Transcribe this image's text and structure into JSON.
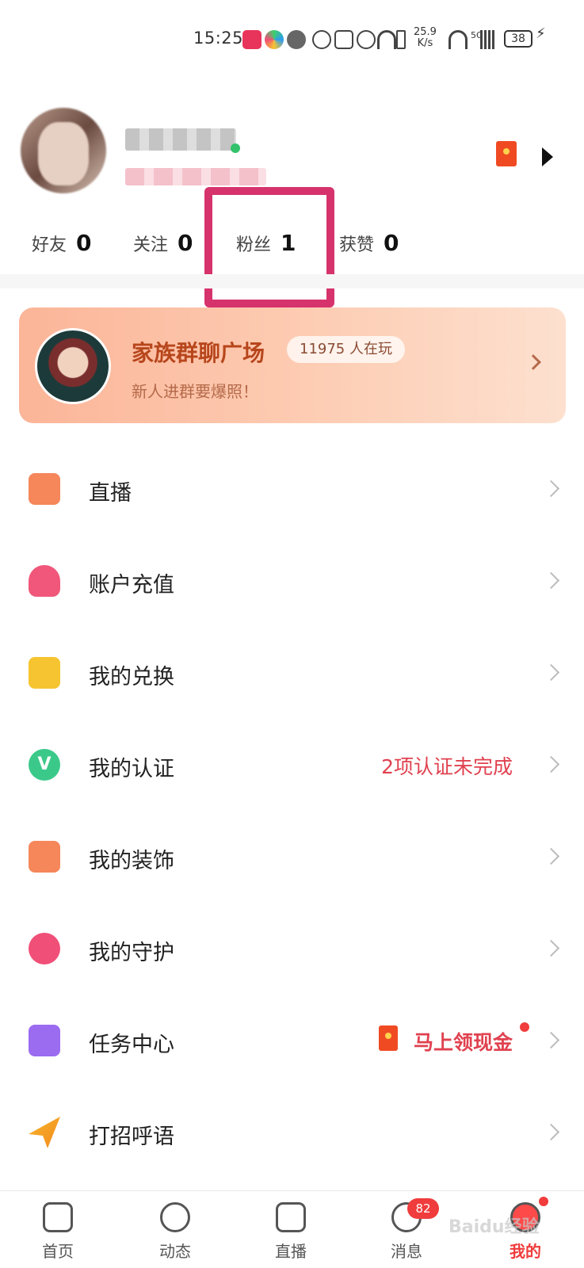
{
  "status_bar": {
    "time": "15:25",
    "net_speed_value": "25.9",
    "net_speed_unit": "K/s",
    "signal_label": "5G",
    "battery": "38"
  },
  "profile": {
    "name": "",
    "subtitle": ""
  },
  "stats": [
    {
      "label": "好友",
      "value": "0"
    },
    {
      "label": "关注",
      "value": "0"
    },
    {
      "label": "粉丝",
      "value": "1"
    },
    {
      "label": "获赞",
      "value": "0"
    }
  ],
  "banner": {
    "title": "家族群聊广场",
    "players": "11975 人在玩",
    "subtitle": "新人进群要爆照！"
  },
  "menu": [
    {
      "label": "直播",
      "extra": "",
      "icon": "tv-icon",
      "color": "#f5875a"
    },
    {
      "label": "账户充值",
      "extra": "",
      "icon": "money-bag-icon",
      "color": "#f0577a"
    },
    {
      "label": "我的兑换",
      "extra": "",
      "icon": "wallet-icon",
      "color": "#f6c431"
    },
    {
      "label": "我的认证",
      "extra": "2项认证未完成",
      "icon": "verified-badge-icon",
      "color": "#3bc98a"
    },
    {
      "label": "我的装饰",
      "extra": "",
      "icon": "picture-icon",
      "color": "#f5875a"
    },
    {
      "label": "我的守护",
      "extra": "",
      "icon": "hearts-icon",
      "color": "#f04f78"
    },
    {
      "label": "任务中心",
      "extra": "马上领现金",
      "icon": "task-list-icon",
      "color": "#9b6bf0"
    },
    {
      "label": "打招呼语",
      "extra": "",
      "icon": "paper-plane-icon",
      "color": "#f6b52a"
    }
  ],
  "tabs": [
    {
      "label": "首页"
    },
    {
      "label": "动态"
    },
    {
      "label": "直播"
    },
    {
      "label": "消息",
      "badge": "82"
    },
    {
      "label": "我的",
      "active": true
    }
  ],
  "watermark": "Baidu经验"
}
